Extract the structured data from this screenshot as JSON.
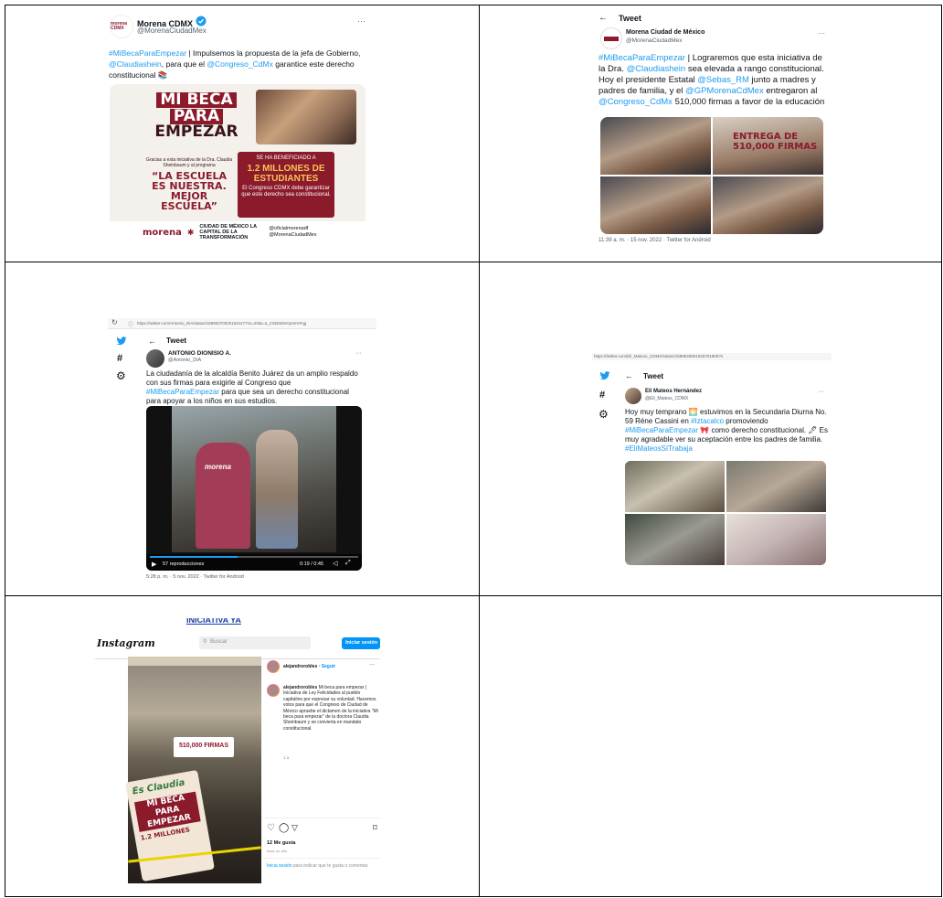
{
  "tweet1": {
    "avatar_text": "morena CDMX",
    "name": "Morena CDMX",
    "handle": "@MorenaCiudadMex",
    "more": "···",
    "text_parts": [
      "#MiBecaParaEmpezar",
      " | Impulsemos la propuesta de la jefa de Gobierno, ",
      "@Claudiashein",
      ", para que el ",
      "@Congreso_CdMx",
      " garantice este derecho constitucional 📚"
    ],
    "poster": {
      "line1": "MI BECA",
      "line2": "PARA",
      "line3": "EMPEZAR",
      "credit": "Gracias a esta iniciativa de la Dra. Claudia Sheinbaum y al programa",
      "slogan": "“LA ESCUELA ES NUESTRA. MEJOR ESCUELA”",
      "box_top": "SE HA BENEFICIADO A",
      "box_big": "1.2 MILLONES DE ESTUDIANTES",
      "box_bottom": "El Congreso CDMX debe garantizar que este derecho sea constitucional.",
      "footer_brand": "morena",
      "footer_city": "CIUDAD DE MÉXICO LA CAPITAL DE LA TRANSFORMACIÓN",
      "footer_social1": "@oficialmorenadf",
      "footer_social2": "@MorenaCiudadMex"
    }
  },
  "tweet2": {
    "back": "←",
    "title": "Tweet",
    "name": "Morena Ciudad de México",
    "handle": "@MorenaCiudadMex",
    "more": "···",
    "text_parts": [
      "#MiBecaParaEmpezar",
      " | Lograremos que esta iniciativa de la Dra. ",
      "@Claudiashein",
      " sea elevada a rango constitucional. Hoy el presidente Estatal ",
      "@Sebas_RM",
      " junto a madres y padres de familia, y el ",
      "@GPMorenaCdMex",
      " entregaron al ",
      "@Congreso_CdMx",
      " 510,000 firmas a favor de la educación"
    ],
    "banner": "ENTREGA DE 510,000 FIRMAS",
    "timestamp": "11:39 a. m. · 15 nov. 2022 · Twitter for Android"
  },
  "tweet3": {
    "url": "https://twitter.com/Antonio_DiA/status/1589637002015011771s=20&t=a_CSDMZeGpVeVFqg",
    "back": "←",
    "title": "Tweet",
    "name": "ANTONIO DIONISIO A.",
    "handle": "@Antonio_DiA",
    "more": "···",
    "text_parts": [
      "La ciudadanía de la alcaldía Benito Juárez da un amplio respaldo con sus firmas para exigirle al Congreso que ",
      "#MiBecaParaEmpezar",
      " para que sea un derecho constitucional para apoyar a los niños en sus estudios."
    ],
    "vest_label": "morena",
    "views": "57 reproducciones",
    "time": "0:19 / 0:45",
    "timestamp": "5:28 p. m. · 5 nov. 2022 · Twitter for Android"
  },
  "tweet4": {
    "url": "https://twitter.com/Eli_Mateos_CDMX/status/1589645801525701806?s",
    "back": "←",
    "title": "Tweet",
    "name": "Eli Mateos Hernández",
    "handle": "@Eli_Mateos_CDMX",
    "more": "···",
    "text_parts": [
      "Hoy muy temprano 🌅 estuvimos en la Secundaria Diurna No. 59 Réne Cassini en ",
      "#Iztacalco",
      " promoviendo ",
      "#MiBecaParaEmpezar",
      " 🎀 como derecho constitucional. 🖋 Es muy agradable ver su aceptación entre los padres de familia. ",
      "#EliMateosSíTrabaja"
    ]
  },
  "instagram": {
    "top_link": "INICIATIVA YA",
    "logo": "Instagram",
    "search_placeholder": "Buscar",
    "login_button": "Iniciar sesión",
    "user": "alejandrorobles",
    "follow": "Seguir",
    "caption_user": "alejandrorobles",
    "caption": "Mi beca para empezar | Iniciativa de Ley Felicidades al pueblo capitalino por expresar su voluntad. Hacemos votos para que el Congreso de Ciudad de México apruebe el dictamen de la iniciativa \"Mi beca para empezar\" de la doctora Claudia Sheinbaum y se convierta en mandato constitucional.",
    "age": "1 a",
    "likes": "12 Me gusta",
    "date": "hace un año",
    "login_prompt_link": "Inicia sesión",
    "login_prompt_rest": " para indicar que te gusta o comentar.",
    "photo_sign1": "Es Claudia",
    "photo_sign2": "MI BECA PARA EMPEZAR",
    "photo_sign3": "1.2 MILLONES",
    "photo_banner": "510,000 FIRMAS"
  },
  "colors": {
    "link": "#1d9bf0",
    "brand": "#8b1a2b",
    "insta_button": "#0095f6"
  }
}
